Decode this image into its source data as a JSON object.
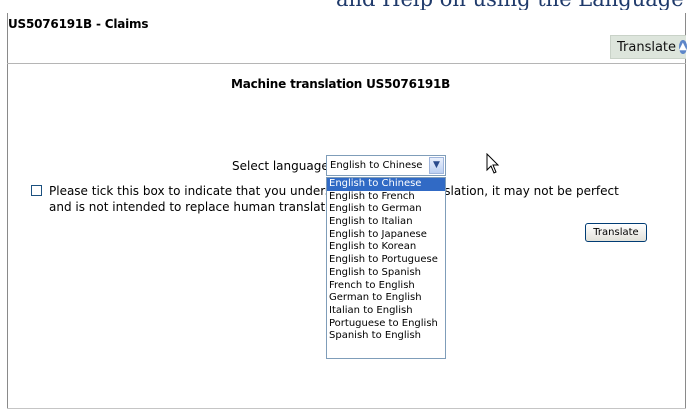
{
  "page": {
    "title": "US5076191B - Claims",
    "translate_tab_label": "Translate"
  },
  "main": {
    "heading": "Machine translation US5076191B",
    "select_label": "Select language:",
    "selected_language": "English to Chinese",
    "notice_line1": "Please tick this box to indicate that you understand",
    "notice_line1_end": "translation, it may not be perfect",
    "notice_line2": "and is not intended to replace human translators.",
    "translate_button": "Translate"
  },
  "dropdown": {
    "options": [
      "English to Chinese",
      "English to French",
      "English to German",
      "English to Italian",
      "English to Japanese",
      "English to Korean",
      "English to Portuguese",
      "English to Spanish",
      "French to English",
      "German to English",
      "Italian to English",
      "Portuguese to English",
      "Spanish to English"
    ],
    "selected_index": 0
  },
  "icons": {
    "translate_tab": "chevron-up-circle-icon",
    "select_button": "chevron-down-icon",
    "cursor": "mouse-pointer-icon"
  },
  "colors": {
    "selected_option_bg": "#316ac5",
    "tab_bg": "#dde5dc",
    "tab_icon": "#5d86c9"
  }
}
